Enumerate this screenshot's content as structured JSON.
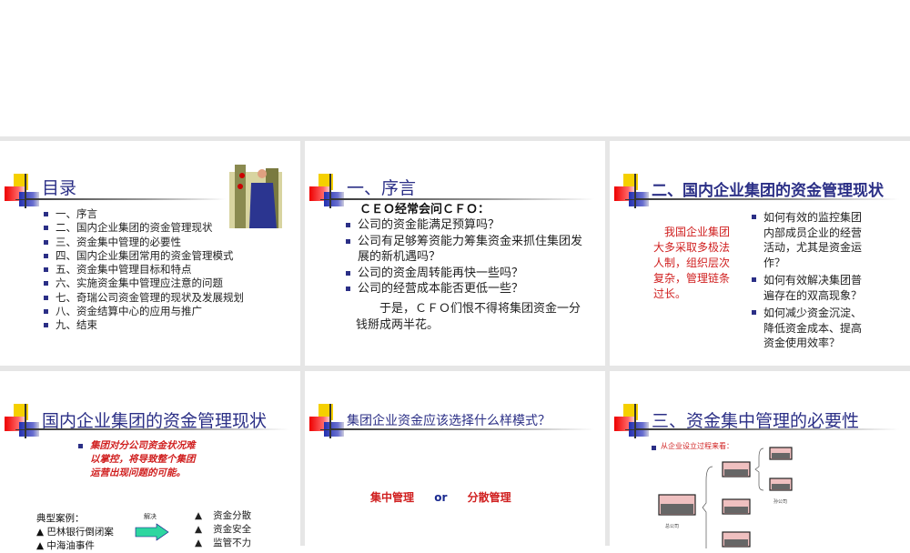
{
  "slides": [
    {
      "title": "目录",
      "items": [
        "一、序言",
        "二、国内企业集团的资金管理现状",
        "三、资金集中管理的必要性",
        "四、国内企业集团常用的资金管理模式",
        "五、资金集中管理目标和特点",
        "六、实施资金集中管理应注意的问题",
        "七、奇瑞公司资金管理的现状及发展规划",
        "八、资金结算中心的应用与推广",
        "九、结束"
      ]
    },
    {
      "title": "一、序言",
      "lead": "ＣＥＯ经常会问ＣＦＯ：",
      "items": [
        "公司的资金能满足预算吗？",
        "公司有足够筹资能力筹集资金来抓住集团发展的新机遇吗？",
        "公司的资金周转能再快一些吗？",
        "公司的经营成本能否更低一些？"
      ],
      "closing": "于是，ＣＦＯ们恨不得将集团资金一分钱掰成两半花。"
    },
    {
      "title": "二、国内企业集团的资金管理现状",
      "note": "我国企业集团大多采取多极法人制，组织层次复杂，管理链条过长。",
      "items": [
        "如何有效的监控集团内部成员企业的经营活动，尤其是资金运作？",
        "如何有效解决集团普遍存在的双高现象？",
        "如何减少资金沉淀、降低资金成本、提高资金使用效率？"
      ]
    },
    {
      "title": "国内企业集团的资金管理现状",
      "item": "集团对分公司资金状况难以掌控，将导致整个集团运营出现问题的可能。",
      "cases_label": "典型案例：",
      "cases": [
        "▲ 巴林银行倒闭案",
        "▲ 中海油事件"
      ],
      "arrow_label": "解决",
      "results": [
        "资金分散",
        "资金安全",
        "监管不力"
      ]
    },
    {
      "title": "集团企业资金应该选择什么样模式？",
      "option_a": "集中管理",
      "or": "or",
      "option_b": "分散管理"
    },
    {
      "title": "三、资金集中管理的必要性",
      "item": "从企业设立过程来看：",
      "parent_label": "总公司",
      "grandchild_label": "孙公司"
    }
  ]
}
